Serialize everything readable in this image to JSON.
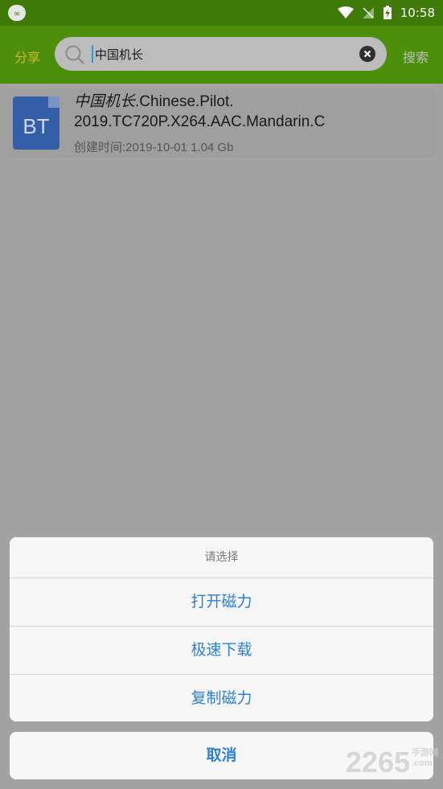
{
  "status_bar": {
    "time": "10:58",
    "icons": [
      "app-icon",
      "wifi-icon",
      "no-signal-icon",
      "battery-charging-icon"
    ]
  },
  "header": {
    "share_label": "分享",
    "search_value": "中国机长",
    "search_label": "搜索"
  },
  "result": {
    "icon_label": "BT",
    "title_italic": "中国机长",
    "title_rest_line1": ".Chinese.Pilot.",
    "title_line2": "2019.TC720P.X264.AAC.Mandarin.C",
    "meta": "创建时间:2019-10-01 1.04 Gb"
  },
  "action_sheet": {
    "title": "请选择",
    "items": [
      {
        "label": "打开磁力"
      },
      {
        "label": "极速下载"
      },
      {
        "label": "复制磁力"
      }
    ],
    "cancel_label": "取消"
  },
  "watermark": {
    "text": "2265",
    "suffix": "手游网",
    "domain": ".com"
  },
  "colors": {
    "header_green": "#4b8f0b",
    "accent_blue": "#2e7fd6",
    "share_yellow": "#d2b52b"
  }
}
